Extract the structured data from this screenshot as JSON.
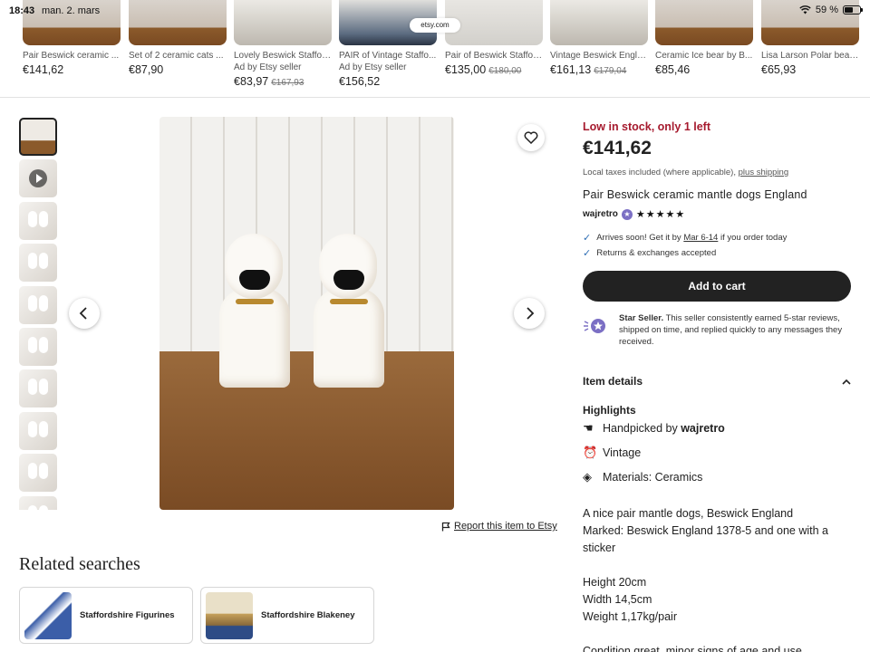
{
  "status_bar": {
    "time": "18:43",
    "date": "man. 2. mars",
    "battery": "59 %",
    "battery_level": 0.59,
    "url": "etsy.com"
  },
  "carousel": [
    {
      "title": "Pair Beswick ceramic ...",
      "ad": "",
      "price": "€141,62",
      "old_price": ""
    },
    {
      "title": "Set of 2 ceramic cats ...",
      "ad": "",
      "price": "€87,90",
      "old_price": ""
    },
    {
      "title": "Lovely Beswick Staffor...",
      "ad": "Ad by Etsy seller",
      "price": "€83,97",
      "old_price": "€167,93"
    },
    {
      "title": "PAIR of Vintage Staffo...",
      "ad": "Ad by Etsy seller",
      "price": "€156,52",
      "old_price": ""
    },
    {
      "title": "Pair of Beswick Staffor...",
      "ad": "",
      "price": "€135,00",
      "old_price": "€180,00"
    },
    {
      "title": "Vintage Beswick Engla...",
      "ad": "",
      "price": "€161,13",
      "old_price": "€179,04"
    },
    {
      "title": "Ceramic Ice bear by B...",
      "ad": "",
      "price": "€85,46",
      "old_price": ""
    },
    {
      "title": "Lisa Larson Polar bear ...",
      "ad": "",
      "price": "€65,93",
      "old_price": ""
    }
  ],
  "gallery": {
    "prev_icon": "chevron-left-icon",
    "next_icon": "chevron-right-icon",
    "favorite_icon": "heart-icon"
  },
  "report_link": "Report this item to Etsy",
  "related": {
    "title": "Related searches",
    "items": [
      "Staffordshire Figurines",
      "Staffordshire Blakeney"
    ]
  },
  "product": {
    "stock": "Low in stock, only 1 left",
    "price": "€141,62",
    "taxes": "Local taxes included (where applicable),",
    "shipping_link": "plus shipping",
    "title": "Pair Beswick ceramic mantle dogs England",
    "seller": "wajretro",
    "stars": "★★★★★",
    "arrives_pre": "Arrives soon! Get it by",
    "arrives_date": "Mar 6-14",
    "arrives_post": "if you order today",
    "returns": "Returns & exchanges accepted",
    "cart_label": "Add to cart",
    "star_seller_bold": "Star Seller.",
    "star_seller_text": "This seller consistently earned 5-star reviews, shipped on time, and replied quickly to any messages they received.",
    "item_details": "Item details",
    "highlights_title": "Highlights",
    "highlights": [
      {
        "pre": "Handpicked by",
        "bold": "wajretro",
        "icon": "hand-icon"
      },
      {
        "pre": "Vintage",
        "bold": "",
        "icon": "alarm-clock-icon"
      },
      {
        "pre": "Materials: Ceramics",
        "bold": "",
        "icon": "layers-icon"
      }
    ],
    "description": [
      "A nice pair mantle dogs, Beswick England",
      "Marked: Beswick England 1378-5 and one with a sticker",
      "",
      "Height 20cm",
      "Width 14,5cm",
      "Weight 1,17kg/pair",
      "",
      "Condition great, minor signs of age and use"
    ]
  },
  "colors": {
    "stock_red": "#a61a2e",
    "cart_bg": "#222222",
    "check_blue": "#2f6fb5",
    "star_seller_purple": "#7b6fc4"
  }
}
